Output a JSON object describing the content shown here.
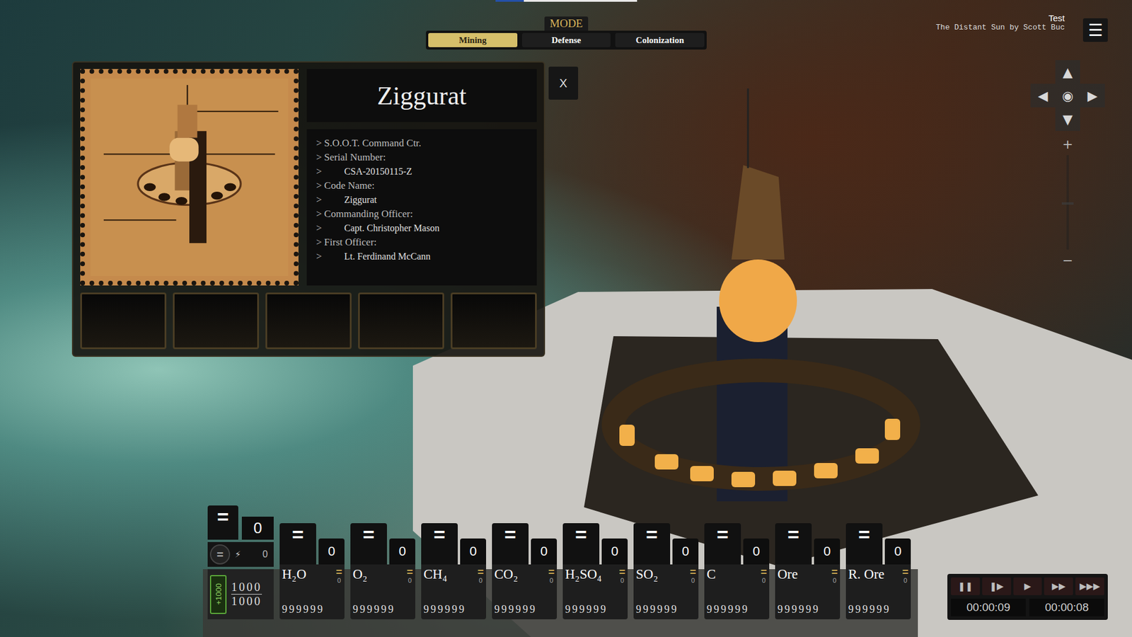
{
  "loading_bar": {
    "level": 0.2
  },
  "mode": {
    "label": "MODE",
    "tabs": [
      {
        "label": "Mining",
        "selected": true
      },
      {
        "label": "Defense",
        "selected": false
      },
      {
        "label": "Colonization",
        "selected": false
      }
    ]
  },
  "header": {
    "title": "Test",
    "subtitle": "The Distant Sun by Scott Buc"
  },
  "menu_button": "☰",
  "camera": {
    "up": "▲",
    "left": "◀",
    "center": "◉",
    "right": "▶",
    "down": "▼",
    "zoom_in": "+",
    "zoom_out": "−",
    "zoom_level": 0.5
  },
  "info_panel": {
    "title": "Ziggurat",
    "close": "X",
    "lines": [
      {
        "marker": ">",
        "text": "S.O.O.T. Command Ctr.",
        "indent": false
      },
      {
        "marker": ">",
        "text": "Serial Number:",
        "indent": false
      },
      {
        "marker": ">",
        "text": "CSA-20150115-Z",
        "indent": true
      },
      {
        "marker": ">",
        "text": "Code Name:",
        "indent": false
      },
      {
        "marker": ">",
        "text": "Ziggurat",
        "indent": true
      },
      {
        "marker": ">",
        "text": "Commanding Officer:",
        "indent": false
      },
      {
        "marker": ">",
        "text": "Capt. Christopher Mason",
        "indent": true
      },
      {
        "marker": ">",
        "text": "First Officer:",
        "indent": false
      },
      {
        "marker": ">",
        "text": "Lt. Ferdinand McCann",
        "indent": true
      }
    ],
    "slots": [
      {
        "filled": false
      },
      {
        "filled": false
      },
      {
        "filled": false
      },
      {
        "filled": false
      },
      {
        "filled": false
      }
    ]
  },
  "energy": {
    "equals": "=",
    "value": "0",
    "toggle": "=",
    "power_icon": "⚡",
    "power": "0",
    "boost": "+1000",
    "current": "1000",
    "max": "1000"
  },
  "resources": [
    {
      "name": "H₂O",
      "equals": "=",
      "amount": "0",
      "rate_equals": "=",
      "rate": "0",
      "capacity": "999999"
    },
    {
      "name": "O₂",
      "equals": "=",
      "amount": "0",
      "rate_equals": "=",
      "rate": "0",
      "capacity": "999999"
    },
    {
      "name": "CH₄",
      "equals": "=",
      "amount": "0",
      "rate_equals": "=",
      "rate": "0",
      "capacity": "999999"
    },
    {
      "name": "CO₂",
      "equals": "=",
      "amount": "0",
      "rate_equals": "=",
      "rate": "0",
      "capacity": "999999"
    },
    {
      "name": "H₂SO₄",
      "equals": "=",
      "amount": "0",
      "rate_equals": "=",
      "rate": "0",
      "capacity": "999999"
    },
    {
      "name": "SO₂",
      "equals": "=",
      "amount": "0",
      "rate_equals": "=",
      "rate": "0",
      "capacity": "999999"
    },
    {
      "name": "C",
      "equals": "=",
      "amount": "0",
      "rate_equals": "=",
      "rate": "0",
      "capacity": "999999"
    },
    {
      "name": "Ore",
      "equals": "=",
      "amount": "0",
      "rate_equals": "=",
      "rate": "0",
      "capacity": "999999"
    },
    {
      "name": "R. Ore",
      "equals": "=",
      "amount": "0",
      "rate_equals": "=",
      "rate": "0",
      "capacity": "999999"
    }
  ],
  "time_controls": {
    "buttons": [
      "❚❚",
      "❚▶",
      "▶",
      "▶▶",
      "▶▶▶"
    ],
    "times": [
      "00:00:09",
      "00:00:08"
    ]
  }
}
